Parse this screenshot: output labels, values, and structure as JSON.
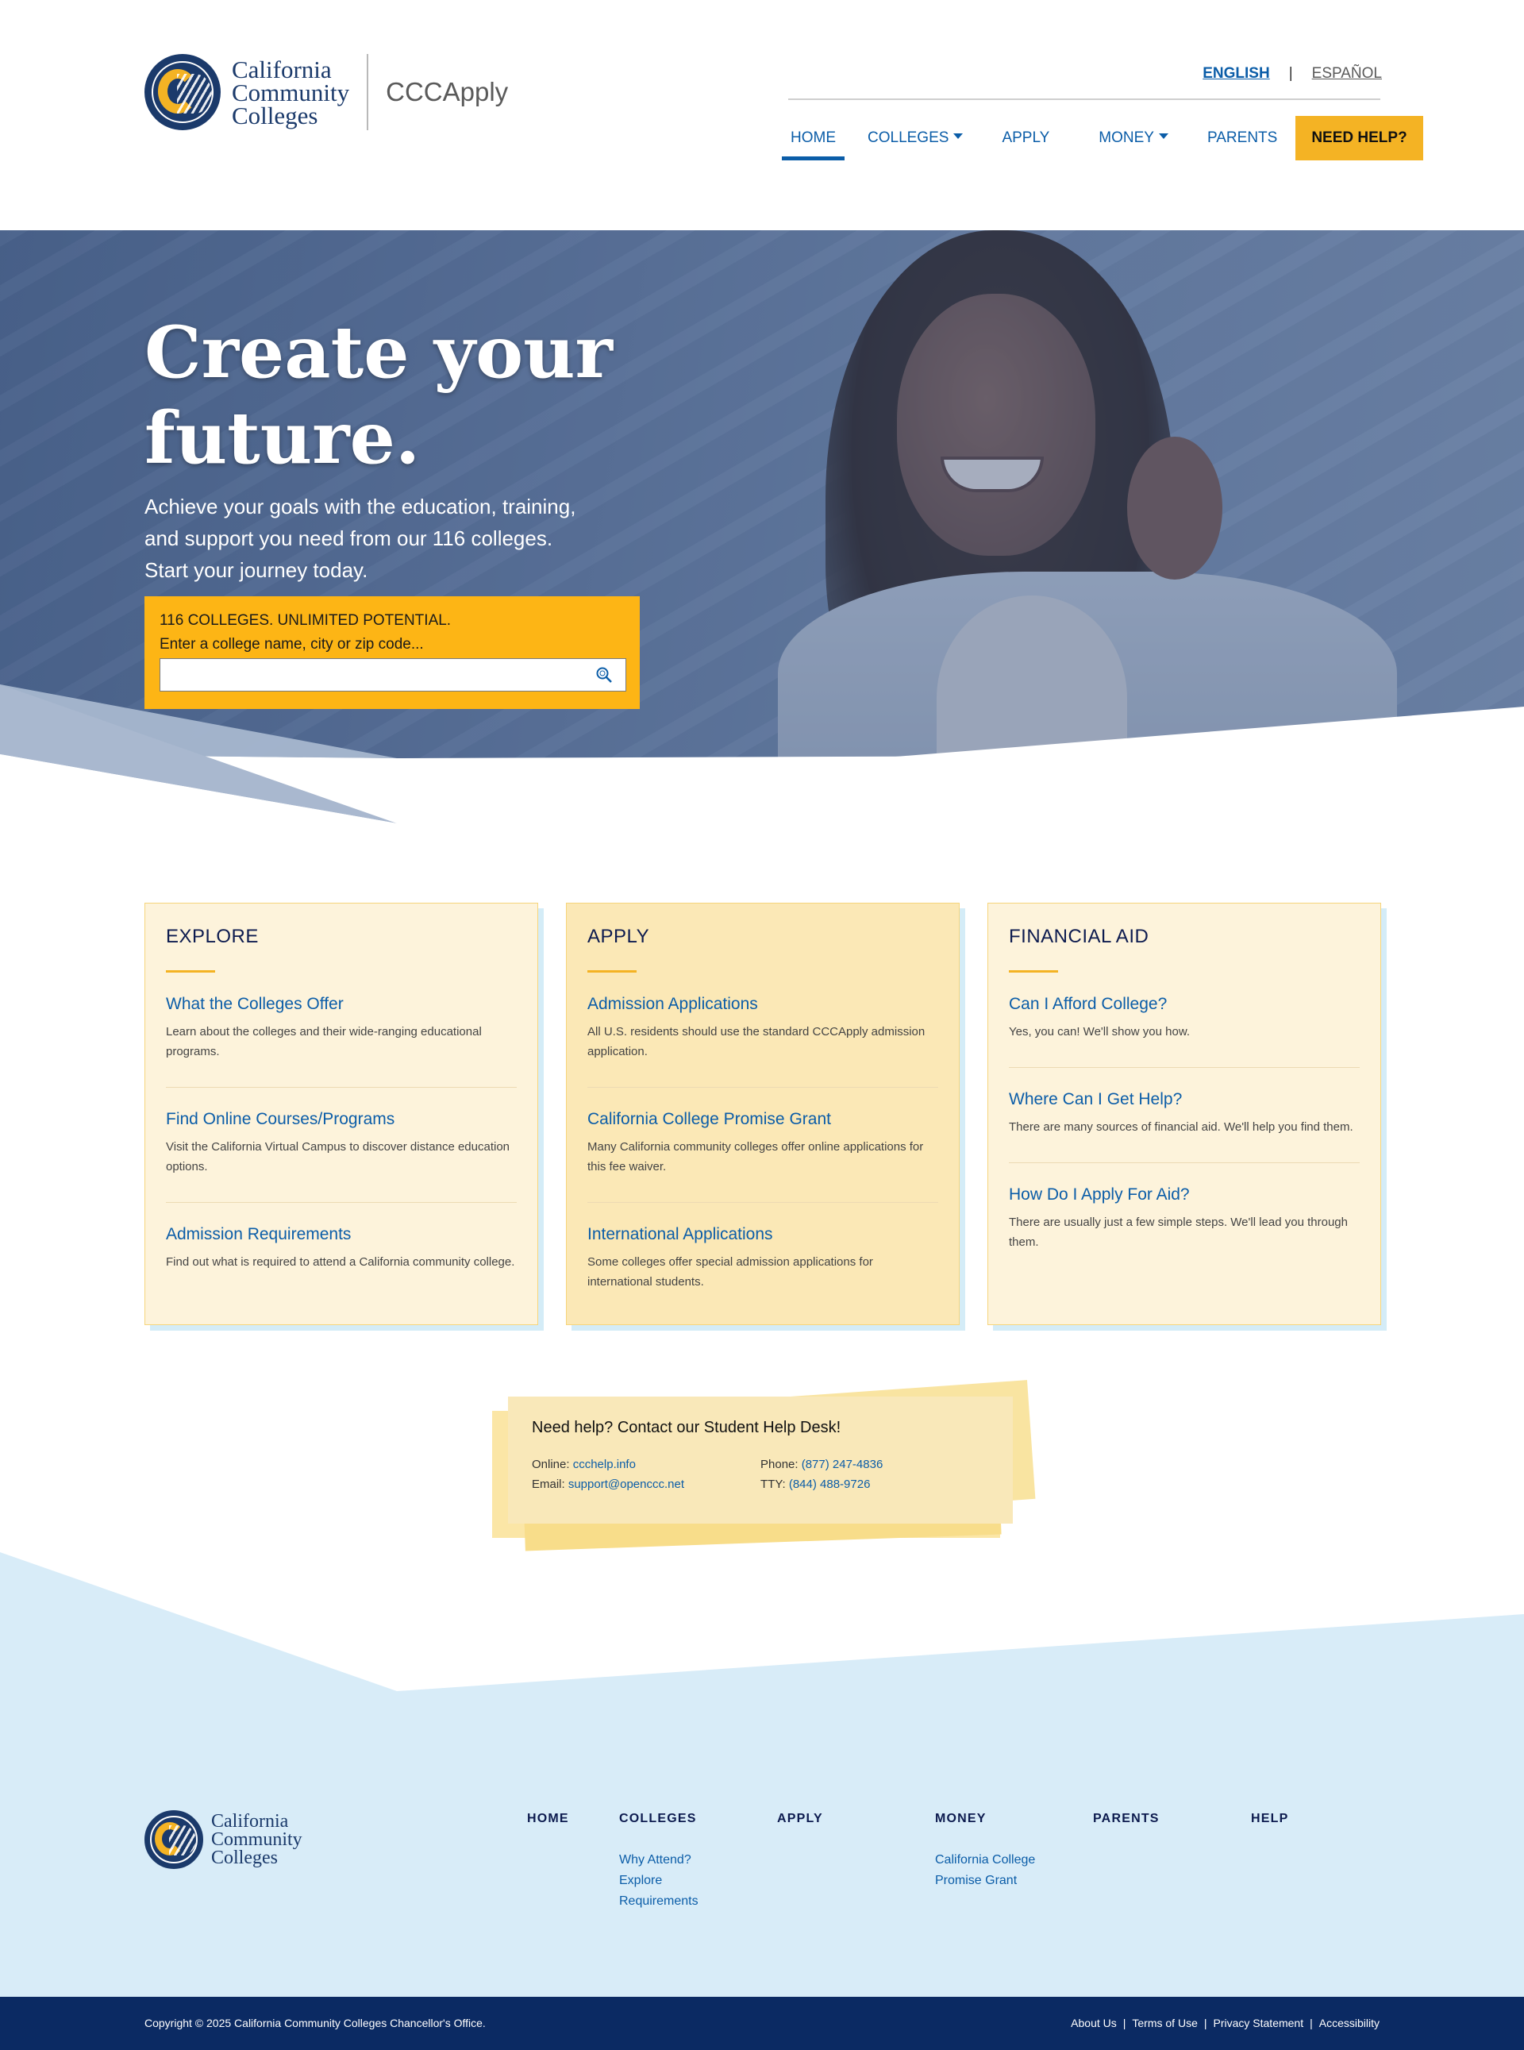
{
  "header": {
    "logo_text": [
      "California",
      "Community",
      "Colleges"
    ],
    "app_name": "CCCApply",
    "lang": {
      "english": "ENGLISH",
      "separator": "|",
      "spanish": "ESPAÑOL"
    },
    "nav": [
      {
        "label": "HOME",
        "active": true,
        "dropdown": false
      },
      {
        "label": "COLLEGES",
        "active": false,
        "dropdown": true
      },
      {
        "label": "APPLY",
        "active": false,
        "dropdown": false
      },
      {
        "label": "MONEY",
        "active": false,
        "dropdown": true
      },
      {
        "label": "PARENTS",
        "active": false,
        "dropdown": false
      }
    ],
    "need_help": "NEED HELP?"
  },
  "hero": {
    "title_line1": "Create your",
    "title_line2": "future.",
    "subtitle": "Achieve your goals with the education, training, and support you need from our 116 colleges. Start your journey today.",
    "search_heading": "116 COLLEGES. UNLIMITED POTENTIAL.",
    "search_label": "Enter a college name, city or zip code...",
    "search_value": ""
  },
  "cards": [
    {
      "title": "EXPLORE",
      "items": [
        {
          "link": "What the Colleges Offer",
          "desc": "Learn about the colleges and their wide-ranging educational programs."
        },
        {
          "link": "Find Online Courses/Programs",
          "desc": "Visit the California Virtual Campus to discover distance education options."
        },
        {
          "link": "Admission Requirements",
          "desc": "Find out what is required to attend a California community college."
        }
      ]
    },
    {
      "title": "APPLY",
      "items": [
        {
          "link": "Admission Applications",
          "desc": "All U.S. residents should use the standard CCCApply admission application."
        },
        {
          "link": "California College Promise Grant",
          "desc": "Many California community colleges offer online applications for this fee waiver."
        },
        {
          "link": "International Applications",
          "desc": "Some colleges offer special admission applications for international students."
        }
      ]
    },
    {
      "title": "FINANCIAL AID",
      "items": [
        {
          "link": "Can I Afford College?",
          "desc": "Yes, you can! We'll show you how."
        },
        {
          "link": "Where Can I Get Help?",
          "desc": "There are many sources of financial aid. We'll help you find them."
        },
        {
          "link": "How Do I Apply For Aid?",
          "desc": "There are usually just a few simple steps. We'll lead you through them."
        }
      ]
    }
  ],
  "help": {
    "title": "Need help? Contact our Student Help Desk!",
    "online_label": "Online: ",
    "online_value": "ccchelp.info",
    "email_label": "Email: ",
    "email_value": "support@openccc.net",
    "phone_label": "Phone: ",
    "phone_value": "(877) 247-4836",
    "tty_label": "TTY: ",
    "tty_value": "(844) 488-9726"
  },
  "footer": {
    "logo_text": [
      "California",
      "Community",
      "Colleges"
    ],
    "columns": [
      {
        "heading": "HOME",
        "links": []
      },
      {
        "heading": "COLLEGES",
        "links": [
          "Why Attend?",
          "Explore",
          "Requirements"
        ]
      },
      {
        "heading": "APPLY",
        "links": []
      },
      {
        "heading": "MONEY",
        "links": [
          "California College",
          "Promise Grant"
        ]
      },
      {
        "heading": "PARENTS",
        "links": []
      },
      {
        "heading": "HELP",
        "links": []
      }
    ],
    "copyright": "Copyright © 2025 California Community Colleges Chancellor's Office.",
    "bottom_links": [
      "About Us",
      "Terms of Use",
      "Privacy Statement",
      "Accessibility"
    ],
    "bottom_separator": "|"
  },
  "colors": {
    "brand_blue": "#0b5da8",
    "navy": "#0b2a63",
    "gold": "#fdb515",
    "light_blue": "#d8ecf8"
  }
}
